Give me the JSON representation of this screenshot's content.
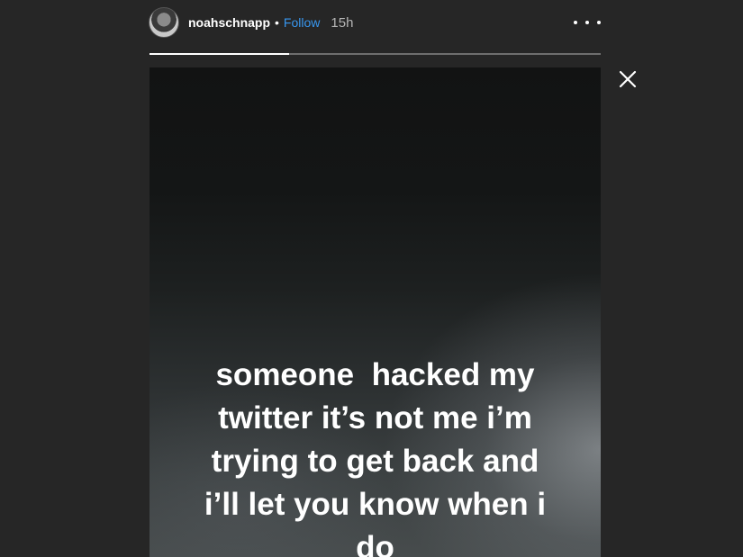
{
  "header": {
    "username": "noahschnapp",
    "separator": "•",
    "follow_label": "Follow",
    "time": "15h",
    "avatar_icon": "profile-avatar",
    "more_icon": "more-options-icon"
  },
  "progress": {
    "segments": 1,
    "fill_fraction": 0.31
  },
  "close_icon": "close-icon",
  "story": {
    "lines": [
      "someone  hacked my",
      "twitter it’s not me i’m",
      "trying to get back and",
      "i’ll let you know when i",
      "do"
    ]
  },
  "colors": {
    "background": "#262626",
    "follow": "#3897f0",
    "text": "#ffffff"
  }
}
